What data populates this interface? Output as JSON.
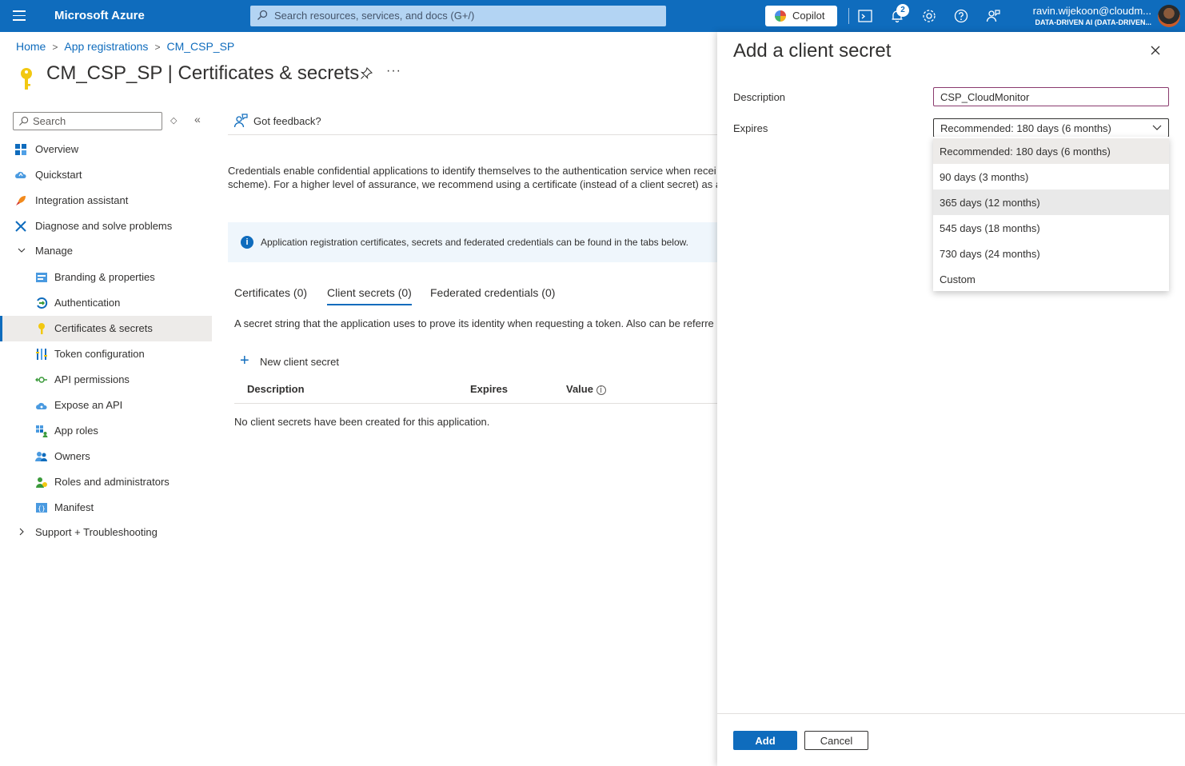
{
  "topbar": {
    "brand": "Microsoft Azure",
    "search_placeholder": "Search resources, services, and docs (G+/)",
    "copilot_label": "Copilot",
    "notification_count": "2",
    "user_name": "ravin.wijekoon@cloudm...",
    "tenant": "DATA-DRIVEN AI (DATA-DRIVEN..."
  },
  "breadcrumb": {
    "home": "Home",
    "app_registrations": "App registrations",
    "app": "CM_CSP_SP"
  },
  "page": {
    "title_app": "CM_CSP_SP",
    "title_sep": " | ",
    "title_section": "Certificates & secrets",
    "more": "···"
  },
  "nav": {
    "search_placeholder": "Search",
    "items": [
      {
        "label": "Overview",
        "icon": "grid-icon"
      },
      {
        "label": "Quickstart",
        "icon": "cloud-quickstart-icon"
      },
      {
        "label": "Integration assistant",
        "icon": "rocket-icon"
      },
      {
        "label": "Diagnose and solve problems",
        "icon": "wrench-icon"
      },
      {
        "label": "Manage",
        "icon": "chevron-down-icon"
      },
      {
        "label": "Branding & properties",
        "icon": "branding-icon"
      },
      {
        "label": "Authentication",
        "icon": "authentication-icon"
      },
      {
        "label": "Certificates & secrets",
        "icon": "key-icon"
      },
      {
        "label": "Token configuration",
        "icon": "token-icon"
      },
      {
        "label": "API permissions",
        "icon": "api-permissions-icon"
      },
      {
        "label": "Expose an API",
        "icon": "cloud-api-icon"
      },
      {
        "label": "App roles",
        "icon": "app-roles-icon"
      },
      {
        "label": "Owners",
        "icon": "owners-icon"
      },
      {
        "label": "Roles and administrators",
        "icon": "roles-icon"
      },
      {
        "label": "Manifest",
        "icon": "manifest-icon"
      },
      {
        "label": "Support + Troubleshooting",
        "icon": "chevron-right-icon"
      }
    ]
  },
  "main": {
    "feedback": "Got feedback?",
    "description_line1": "Credentials enable confidential applications to identify themselves to the authentication service when recei",
    "description_line2": "scheme). For a higher level of assurance, we recommend using a certificate (instead of a client secret) as a c",
    "info": "Application registration certificates, secrets and federated credentials can be found in the tabs below.",
    "tabs": [
      "Certificates (0)",
      "Client secrets (0)",
      "Federated credentials (0)"
    ],
    "secret_description": "A secret string that the application uses to prove its identity when requesting a token. Also can be referre",
    "new_secret": "New client secret",
    "columns": [
      "Description",
      "Expires",
      "Value"
    ],
    "empty": "No client secrets have been created for this application."
  },
  "panel": {
    "title": "Add a client secret",
    "description_label": "Description",
    "description_value": "CSP_CloudMonitor",
    "expires_label": "Expires",
    "expires_selected": "Recommended: 180 days (6 months)",
    "options": [
      "Recommended: 180 days (6 months)",
      "90 days (3 months)",
      "365 days (12 months)",
      "545 days (18 months)",
      "730 days (24 months)",
      "Custom"
    ],
    "add_label": "Add",
    "cancel_label": "Cancel"
  },
  "colors": {
    "accent": "#0f6cbd",
    "info_bg": "#eff6fc",
    "selected_bg": "#edebe9"
  }
}
